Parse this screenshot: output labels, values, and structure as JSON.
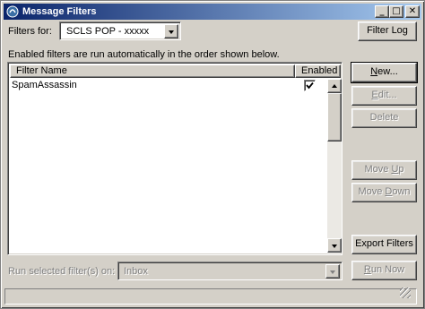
{
  "window": {
    "title": "Message Filters",
    "minimize_glyph": "_",
    "maximize_glyph": "□",
    "close_glyph": "✕"
  },
  "toolbar": {
    "filters_for_label": "Filters for:",
    "account_value": "SCLS POP - xxxxx",
    "filter_log_label": "Filter Log"
  },
  "description": "Enabled filters are run automatically in the order shown below.",
  "filter_list": {
    "columns": [
      "Filter Name",
      "Enabled"
    ],
    "rows": [
      {
        "name": "SpamAssassin",
        "enabled": true
      }
    ]
  },
  "buttons": {
    "new": "New...",
    "edit": "Edit...",
    "delete": "Delete",
    "move_up": "Move Up",
    "move_down": "Move Down",
    "export_filters": "Export Filters",
    "run_now": "Run Now"
  },
  "run_selected": {
    "label": "Run selected filter(s) on:",
    "folder_value": "Inbox"
  },
  "icons": {
    "app": "app-icon",
    "check": "checkmark-icon"
  },
  "colors": {
    "title_gradient_start": "#0a246a",
    "title_gradient_end": "#a6caf0",
    "face": "#d4d0c8",
    "disabled_text": "#808080"
  }
}
